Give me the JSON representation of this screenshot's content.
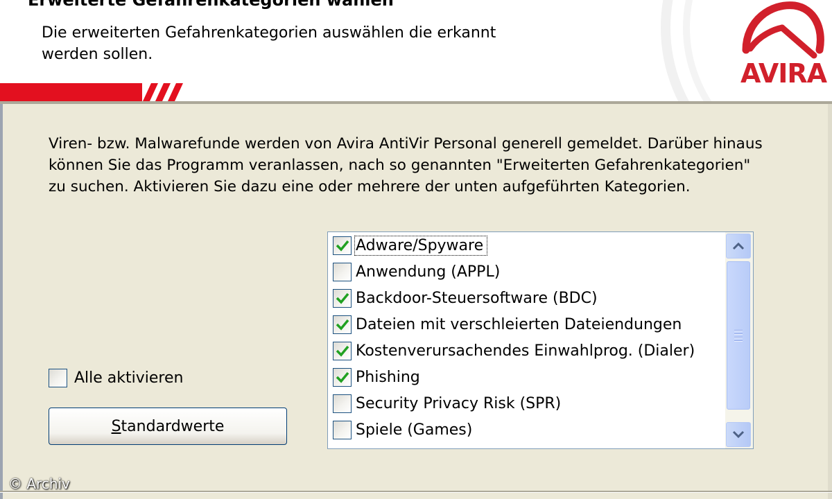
{
  "header": {
    "title": "Erweiterte Gefahrenkategorien wählen",
    "subtitle": "Die erweiterten Gefahrenkategorien auswählen die erkannt werden sollen.",
    "logo_text": "AVIRA",
    "brand_color": "#e3101f"
  },
  "description": "Viren- bzw. Malwarefunde werden von Avira AntiVir Personal generell gemeldet. Darüber hinaus können Sie das Programm veranlassen, nach so genannten \"Erweiterten Gefahrenkategorien\" zu suchen. Aktivieren Sie dazu eine oder mehrere der unten aufgeführten Kategorien.",
  "check_all": {
    "label": "Alle aktivieren",
    "checked": false
  },
  "defaults_button": {
    "label_underlined": "S",
    "label_rest": "tandardwerte"
  },
  "categories": [
    {
      "label": "Adware/Spyware",
      "checked": true,
      "focused": true
    },
    {
      "label": "Anwendung (APPL)",
      "checked": false
    },
    {
      "label": "Backdoor-Steuersoftware (BDC)",
      "checked": true
    },
    {
      "label": "Dateien mit verschleierten Dateiendungen",
      "checked": true
    },
    {
      "label": "Kostenverursachendes Einwahlprog. (Dialer)",
      "checked": true
    },
    {
      "label": "Phishing",
      "checked": true
    },
    {
      "label": "Security Privacy Risk (SPR)",
      "checked": false
    },
    {
      "label": "Spiele (Games)",
      "checked": false
    }
  ],
  "icons": {
    "scroll_up": "chevron-up-icon",
    "scroll_down": "chevron-down-icon",
    "check": "checkmark-icon"
  },
  "watermark": "© Archiv"
}
